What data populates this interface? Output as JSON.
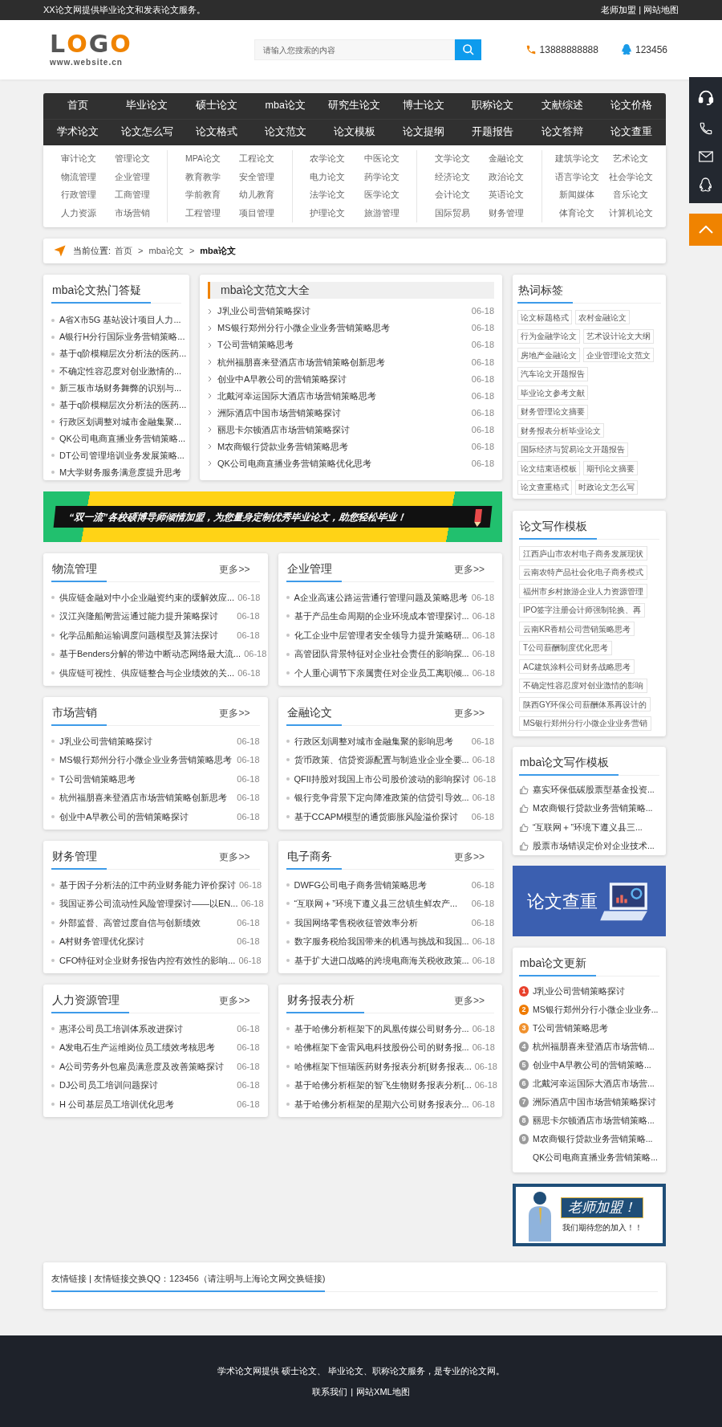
{
  "top_bar": {
    "notice": "XX论文网提供毕业论文和发表论文服务。",
    "links": [
      "老师加盟",
      "网站地图"
    ],
    "separator": "|"
  },
  "header": {
    "logo": {
      "text": "LOGO",
      "subtitle": "www.website.cn"
    },
    "search": {
      "placeholder": "请输入您搜索的内容"
    },
    "phone": "13888888888",
    "qq": "123456"
  },
  "nav": {
    "rows": [
      [
        "首页",
        "毕业论文",
        "硕士论文",
        "mba论文",
        "研究生论文",
        "博士论文",
        "职称论文",
        "文献综述",
        "论文价格"
      ],
      [
        "学术论文",
        "论文怎么写",
        "论文格式",
        "论文范文",
        "论文模板",
        "论文提纲",
        "开题报告",
        "论文答辩",
        "论文查重"
      ]
    ]
  },
  "categories": [
    [
      "审计论文",
      "管理论文",
      "物流管理",
      "企业管理",
      "行政管理",
      "工商管理",
      "人力资源",
      "市场营销"
    ],
    [
      "MPA论文",
      "工程论文",
      "教育教学",
      "安全管理",
      "学前教育",
      "幼儿教育",
      "工程管理",
      "项目管理"
    ],
    [
      "农学论文",
      "中医论文",
      "电力论文",
      "药学论文",
      "法学论文",
      "医学论文",
      "护理论文",
      "旅游管理"
    ],
    [
      "文学论文",
      "金融论文",
      "经济论文",
      "政治论文",
      "会计论文",
      "英语论文",
      "国际贸易",
      "财务管理"
    ],
    [
      "建筑学论文",
      "艺术论文",
      "语言学论文",
      "社会学论文",
      "新闻媒体",
      "音乐论文",
      "体育论文",
      "计算机论文"
    ]
  ],
  "breadcrumb": {
    "label": "当前位置:",
    "separator": ">",
    "items": [
      {
        "text": "首页",
        "current": false
      },
      {
        "text": "mba论文",
        "current": false
      },
      {
        "text": "mba论文",
        "current": true
      }
    ]
  },
  "hot_questions": {
    "title": "mba论文热门答疑",
    "items": [
      "A省X市5G 基站设计项目人力...",
      "A银行H分行国际业务营销策略...",
      "基于q阶模糊层次分析法的医药...",
      "不确定性容忍度对创业激情的...",
      "新三板市场财务舞弊的识别与...",
      "基于q阶模糊层次分析法的医药...",
      "行政区划调整对城市金融集聚...",
      "QK公司电商直播业务营销策略...",
      "DT公司管理培训业务发展策略...",
      "M大学财务服务满意度提升思考"
    ]
  },
  "sample_papers": {
    "title": "mba论文范文大全",
    "items": [
      {
        "title": "J乳业公司营销策略探讨",
        "date": "06-18"
      },
      {
        "title": "MS银行郑州分行小微企业业务营销策略思考",
        "date": "06-18"
      },
      {
        "title": "T公司营销策略思考",
        "date": "06-18"
      },
      {
        "title": "杭州福朋喜来登酒店市场营销策略创新思考",
        "date": "06-18"
      },
      {
        "title": "创业中A早教公司的营销策略探讨",
        "date": "06-18"
      },
      {
        "title": "北戴河幸运国际大酒店市场营销策略思考",
        "date": "06-18"
      },
      {
        "title": "洲际酒店中国市场营销策略探讨",
        "date": "06-18"
      },
      {
        "title": "丽思卡尔顿酒店市场营销策略探讨",
        "date": "06-18"
      },
      {
        "title": "M农商银行贷款业务营销策略思考",
        "date": "06-18"
      },
      {
        "title": "QK公司电商直播业务营销策略优化思考",
        "date": "06-18"
      }
    ]
  },
  "promo_banner": {
    "text": "“双一流”各校硕博导师倾情加盟，为您量身定制优秀毕业论文，助您轻松毕业！"
  },
  "sections": [
    {
      "title": "物流管理",
      "more": "更多>>",
      "items": [
        {
          "title": "供应链金融对中小企业融资约束的缓解效应...",
          "date": "06-18"
        },
        {
          "title": "汉江兴隆船闸营运通过能力提升策略探讨",
          "date": "06-18"
        },
        {
          "title": "化学品船舶运输调度问题模型及算法探讨",
          "date": "06-18"
        },
        {
          "title": "基于Benders分解的带边中断动态网络最大流...",
          "date": "06-18"
        },
        {
          "title": "供应链可视性、供应链整合与企业绩效的关...",
          "date": "06-18"
        }
      ]
    },
    {
      "title": "企业管理",
      "more": "更多>>",
      "items": [
        {
          "title": "A企业高速公路运营通行管理问题及策略思考",
          "date": "06-18"
        },
        {
          "title": "基于产品生命周期的企业环境成本管理探讨...",
          "date": "06-18"
        },
        {
          "title": "化工企业中层管理者安全领导力提升策略研...",
          "date": "06-18"
        },
        {
          "title": "高管团队背景特征对企业社会责任的影响探...",
          "date": "06-18"
        },
        {
          "title": "个人重心调节下亲属责任对企业员工离职倾...",
          "date": "06-18"
        }
      ]
    },
    {
      "title": "市场营销",
      "more": "更多>>",
      "items": [
        {
          "title": "J乳业公司营销策略探讨",
          "date": "06-18"
        },
        {
          "title": "MS银行郑州分行小微企业业务营销策略思考",
          "date": "06-18"
        },
        {
          "title": "T公司营销策略思考",
          "date": "06-18"
        },
        {
          "title": "杭州福朋喜来登酒店市场营销策略创新思考",
          "date": "06-18"
        },
        {
          "title": "创业中A早教公司的营销策略探讨",
          "date": "06-18"
        }
      ]
    },
    {
      "title": "金融论文",
      "more": "更多>>",
      "items": [
        {
          "title": "行政区划调整对城市金融集聚的影响思考",
          "date": "06-18"
        },
        {
          "title": "货币政策、信贷资源配置与制造业企业全要...",
          "date": "06-18"
        },
        {
          "title": "QFII持股对我国上市公司股价波动的影响探讨",
          "date": "06-18"
        },
        {
          "title": "银行竞争背景下定向降准政策的信贷引导效...",
          "date": "06-18"
        },
        {
          "title": "基于CCAPM模型的通货膨胀风险溢价探讨",
          "date": "06-18"
        }
      ]
    },
    {
      "title": "财务管理",
      "more": "更多>>",
      "items": [
        {
          "title": "基于因子分析法的江中药业财务能力评价探讨",
          "date": "06-18"
        },
        {
          "title": "我国证券公司流动性风险管理探讨——以EN...",
          "date": "06-18"
        },
        {
          "title": "外部监督、高管过度自信与创新绩效",
          "date": "06-18"
        },
        {
          "title": "A村财务管理优化探讨",
          "date": "06-18"
        },
        {
          "title": "CFO特征对企业财务报告内控有效性的影响...",
          "date": "06-18"
        }
      ]
    },
    {
      "title": "电子商务",
      "more": "更多>>",
      "items": [
        {
          "title": "DWFG公司电子商务营销策略思考",
          "date": "06-18"
        },
        {
          "title": "“互联网＋”环境下遵义县三岔镇生鲜农产...",
          "date": "06-18"
        },
        {
          "title": "我国网络零售税收征管效率分析",
          "date": "06-18"
        },
        {
          "title": "数字服务税给我国带来的机遇与挑战和我国...",
          "date": "06-18"
        },
        {
          "title": "基于扩大进口战略的跨境电商海关税收政策...",
          "date": "06-18"
        }
      ]
    },
    {
      "title": "人力资源管理",
      "more": "更多>>",
      "items": [
        {
          "title": "惠泽公司员工培训体系改进探讨",
          "date": "06-18"
        },
        {
          "title": "A发电石生产运维岗位员工绩效考核思考",
          "date": "06-18"
        },
        {
          "title": "A公司劳务外包雇员满意度及改善策略探讨",
          "date": "06-18"
        },
        {
          "title": "DJ公司员工培训问题探讨",
          "date": "06-18"
        },
        {
          "title": "H 公司基层员工培训优化思考",
          "date": "06-18"
        }
      ]
    },
    {
      "title": "财务报表分析",
      "more": "更多>>",
      "items": [
        {
          "title": "基于哈佛分析框架下的凤凰传媒公司财务分...",
          "date": "06-18"
        },
        {
          "title": "哈佛框架下金雷风电科技股份公司的财务报...",
          "date": "06-18"
        },
        {
          "title": "哈佛框架下恒瑞医药财务报表分析[财务报表...",
          "date": "06-18"
        },
        {
          "title": "基于哈佛分析框架的智飞生物财务报表分析[...",
          "date": "06-18"
        },
        {
          "title": "基于哈佛分析框架的星期六公司财务报表分...",
          "date": "06-18"
        }
      ]
    }
  ],
  "hot_tags": {
    "title": "热词标签",
    "tags": [
      "论文标题格式",
      "农村金融论文",
      "行为金融学论文",
      "艺术设计论文大纲",
      "房地产金融论文",
      "企业管理论文范文",
      "汽车论文开题报告",
      "毕业论文参考文献",
      "财务管理论文摘要",
      "财务报表分析毕业论文",
      "国际经济与贸易论文开题报告",
      "论文结束语模板",
      "期刊论文摘要",
      "论文查重格式",
      "时政论文怎么写"
    ]
  },
  "writing_templates": {
    "title": "论文写作模板",
    "items": [
      "江西庐山市农村电子商务发展现状",
      "云南农特产品社会化电子商务模式",
      "福州市乡村旅游企业人力资源管理",
      "IPO签字注册会计师强制轮换、再",
      "云南KR香精公司营销策略思考",
      "T公司薪酬制度优化思考",
      "AC建筑涂料公司财务战略思考",
      "不确定性容忍度对创业激情的影响",
      "陕西GY环保公司薪酬体系再设计的",
      "MS银行郑州分行小微企业业务营销"
    ]
  },
  "mba_templates": {
    "title": "mba论文写作模板",
    "items": [
      "嘉实环保低碳股票型基金投资...",
      "M农商银行贷款业务营销策略...",
      "“互联网＋”环境下遵义县三...",
      "股票市场错误定价对企业技术..."
    ]
  },
  "check_banner": {
    "text": "论文查重"
  },
  "mba_updates": {
    "title": "mba论文更新",
    "items": [
      {
        "rank": "1",
        "color": "#e8412c",
        "title": "J乳业公司营销策略探讨"
      },
      {
        "rank": "2",
        "color": "#ef7a00",
        "title": "MS银行郑州分行小微企业业务..."
      },
      {
        "rank": "3",
        "color": "#f0912e",
        "title": "T公司营销策略思考"
      },
      {
        "rank": "4",
        "color": "#9b9b9b",
        "title": "杭州福朋喜来登酒店市场营销..."
      },
      {
        "rank": "5",
        "color": "#9b9b9b",
        "title": "创业中A早教公司的营销策略..."
      },
      {
        "rank": "6",
        "color": "#9b9b9b",
        "title": "北戴河幸运国际大酒店市场营..."
      },
      {
        "rank": "7",
        "color": "#9b9b9b",
        "title": "洲际酒店中国市场营销策略探讨"
      },
      {
        "rank": "8",
        "color": "#9b9b9b",
        "title": "丽思卡尔顿酒店市场营销策略..."
      },
      {
        "rank": "9",
        "color": "#9b9b9b",
        "title": "M农商银行贷款业务营销策略..."
      },
      {
        "title": "QK公司电商直播业务营销策略..."
      }
    ]
  },
  "teacher_banner": {
    "title": "老师加盟！",
    "subtitle": "我们期待您的加入！！"
  },
  "friend_links": {
    "text": "友情链接 | 友情链接交换QQ：123456（请注明与上海论文网交换链接)"
  },
  "footer": {
    "text": "学术论文网提供 硕士论文、 毕业论文、职称论文服务，是专业的论文网。",
    "links": [
      "联系我们",
      "网站XML地图"
    ],
    "separator": "|"
  }
}
